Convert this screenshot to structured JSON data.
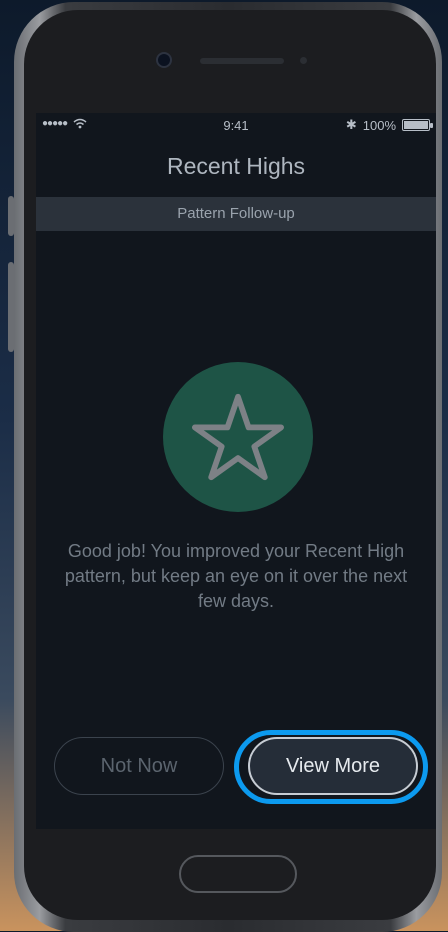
{
  "status_bar": {
    "signal": "●●●●●",
    "time": "9:41",
    "bluetooth": "✱",
    "battery": "100%",
    "battery_level": 1.0
  },
  "nav": {
    "title": "Recent Highs"
  },
  "sub_header": {
    "label": "Pattern Follow-up"
  },
  "content": {
    "icon": "star-icon",
    "message": "Good job! You improved your Recent High pattern, but keep an eye on it over the next few days."
  },
  "buttons": {
    "not_now": "Not Now",
    "view_more": "View More"
  },
  "colors": {
    "accent_circle": "#1e5446",
    "highlight": "#0c9aef"
  }
}
